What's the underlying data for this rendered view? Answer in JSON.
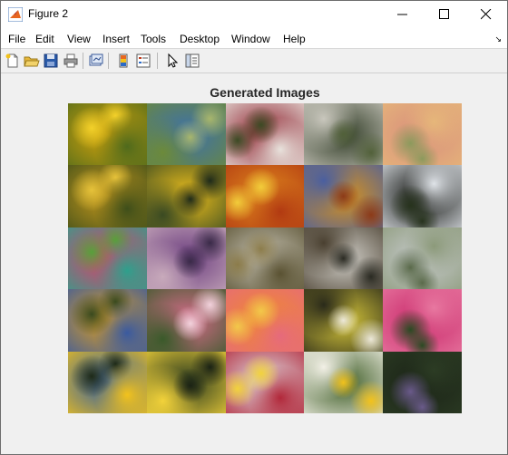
{
  "window": {
    "title": "Figure 2",
    "controls": {
      "minimize": "minimize",
      "maximize": "maximize",
      "close": "close"
    }
  },
  "menu": {
    "items": [
      "File",
      "Edit",
      "View",
      "Insert",
      "Tools",
      "Desktop",
      "Window",
      "Help"
    ],
    "dock_arrow": "↘"
  },
  "toolbar": {
    "buttons": [
      "new-figure-icon",
      "open-file-icon",
      "save-icon",
      "print-icon",
      "link-plot-icon",
      "insert-colorbar-icon",
      "insert-legend-icon",
      "edit-plot-icon",
      "property-inspector-icon"
    ]
  },
  "plot": {
    "title": "Generated Images",
    "rows": 5,
    "cols": 5,
    "tiles": [
      {
        "desc": "yellow-sunflower",
        "c1": "#d9a60a",
        "c2": "#4f6a1c",
        "c3": "#f3d12a"
      },
      {
        "desc": "meadow-blue-sky",
        "c1": "#3b6fae",
        "c2": "#6c8a3a",
        "c3": "#a8b66c"
      },
      {
        "desc": "red-white-bouquet",
        "c1": "#8c1c2a",
        "c2": "#e8e2dc",
        "c3": "#3c4a24"
      },
      {
        "desc": "white-flower-dark",
        "c1": "#2f3b25",
        "c2": "#c9c7bd",
        "c3": "#52613a"
      },
      {
        "desc": "pink-peach-blossoms",
        "c1": "#d88d7c",
        "c2": "#e6b77a",
        "c3": "#8c9a5c"
      },
      {
        "desc": "yellow-field",
        "c1": "#c99a1c",
        "c2": "#3e4e1a",
        "c3": "#e6c23a"
      },
      {
        "desc": "yellow-blossom-dark",
        "c1": "#f1c21c",
        "c2": "#3a4a22",
        "c3": "#1e2a1a"
      },
      {
        "desc": "orange-red-cluster",
        "c1": "#e08a1e",
        "c2": "#b23a12",
        "c3": "#f2cc3a"
      },
      {
        "desc": "orange-blue-mix",
        "c1": "#d8921c",
        "c2": "#4a5fa0",
        "c3": "#8c3a18"
      },
      {
        "desc": "white-flower-black",
        "c1": "#0c0e0a",
        "c2": "#dfe3e8",
        "c3": "#27331d"
      },
      {
        "desc": "pink-green-teal",
        "c1": "#e23c6a",
        "c2": "#2ea08c",
        "c3": "#58a03a"
      },
      {
        "desc": "purple-cluster",
        "c1": "#6a3c7e",
        "c2": "#c8aabb",
        "c3": "#3a2a48"
      },
      {
        "desc": "rocky-landscape",
        "c1": "#c8c4b6",
        "c2": "#5a5232",
        "c3": "#8c7c4a"
      },
      {
        "desc": "white-blossoms-dark",
        "c1": "#d4d2cc",
        "c2": "#4a4030",
        "c3": "#2a2a22"
      },
      {
        "desc": "pale-grey-green",
        "c1": "#c8cbce",
        "c2": "#8c9a7a",
        "c3": "#5a6a4a"
      },
      {
        "desc": "yellow-blue-cluster",
        "c1": "#e0a01e",
        "c2": "#3a5aa0",
        "c3": "#3a4a1e"
      },
      {
        "desc": "pink-tulips",
        "c1": "#d86c8c",
        "c2": "#3a5a2a",
        "c3": "#f2d2dc"
      },
      {
        "desc": "orange-pink-blur",
        "c1": "#f08a2c",
        "c2": "#e66a7c",
        "c3": "#f2c84a"
      },
      {
        "desc": "yellow-white-dark",
        "c1": "#d8c83a",
        "c2": "#2a2a1a",
        "c3": "#ece8d8"
      },
      {
        "desc": "magenta-pink-flowers",
        "c1": "#c8286a",
        "c2": "#e878a0",
        "c3": "#2a4a22"
      },
      {
        "desc": "yellow-on-blue",
        "c1": "#2a5aa8",
        "c2": "#f2c21c",
        "c3": "#1e2a18"
      },
      {
        "desc": "yellow-star-dark",
        "c1": "#2a3a1e",
        "c2": "#f2d23a",
        "c3": "#1a2214"
      },
      {
        "desc": "white-red-bloom",
        "c1": "#dfe0e6",
        "c2": "#b2283a",
        "c3": "#f2d23c"
      },
      {
        "desc": "white-yellow-bud",
        "c1": "#3a5a22",
        "c2": "#f2f0e6",
        "c3": "#f2c21c"
      },
      {
        "desc": "dark-green-foliage",
        "c1": "#1a2216",
        "c2": "#2c3c24",
        "c3": "#6a5a8a"
      }
    ]
  }
}
